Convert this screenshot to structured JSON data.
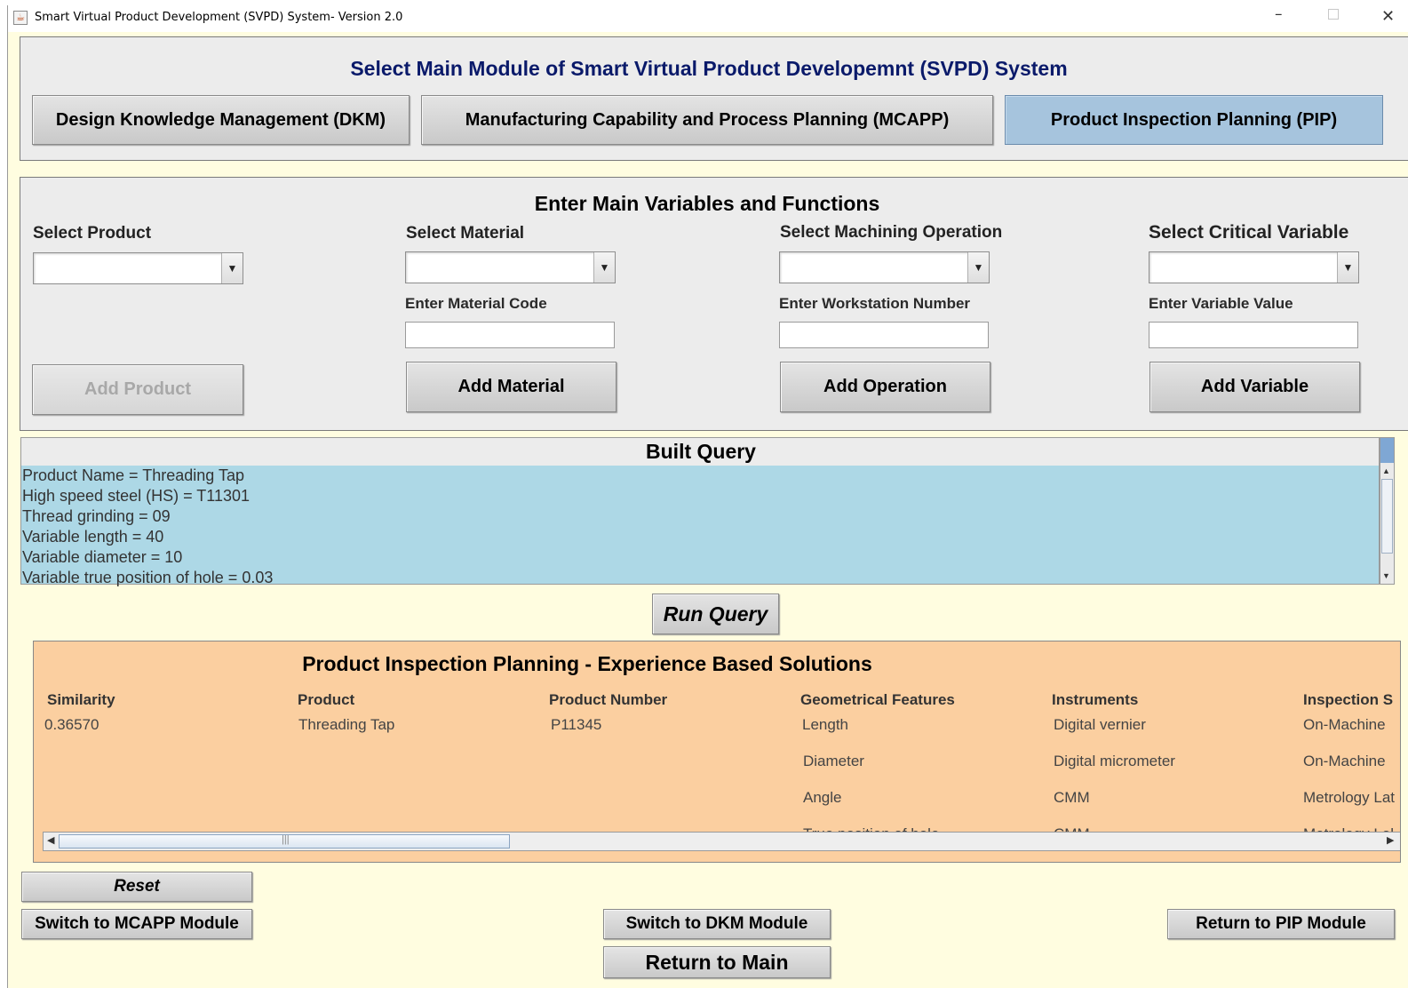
{
  "window": {
    "title": "Smart Virtual Product Development (SVPD) System- Version 2.0",
    "app_icon": "java-icon",
    "controls": {
      "minimize": "–",
      "maximize": "",
      "close": "✕"
    }
  },
  "main_module": {
    "heading": "Select Main Module of Smart Virtual Product Developemnt (SVPD) System",
    "buttons": [
      {
        "label": "Design Knowledge Management (DKM)",
        "active": false
      },
      {
        "label": "Manufacturing Capability and Process Planning (MCAPP)",
        "active": false
      },
      {
        "label": "Product Inspection Planning (PIP)",
        "active": true
      }
    ]
  },
  "variables": {
    "heading": "Enter Main Variables and Functions",
    "product": {
      "label": "Select Product",
      "value": "",
      "button": "Add Product",
      "button_enabled": false
    },
    "material": {
      "label": "Select Material",
      "value": "",
      "code_label": "Enter Material Code",
      "code_value": "",
      "button": "Add Material"
    },
    "operation": {
      "label": "Select Machining Operation",
      "value": "",
      "workstation_label": "Enter Workstation Number",
      "workstation_value": "",
      "button": "Add Operation"
    },
    "variable": {
      "label": "Select Critical Variable",
      "value": "",
      "value_label": "Enter Variable Value",
      "value_value": "",
      "button": "Add Variable"
    }
  },
  "query": {
    "heading": "Built Query",
    "lines": [
      "Product Name = Threading Tap",
      "High speed steel (HS) = T11301",
      "Thread grinding = 09",
      "Variable length = 40",
      "Variable diameter = 10",
      "Variable true position of hole = 0.03"
    ],
    "run_button": "Run Query"
  },
  "results": {
    "heading": "Product Inspection Planning - Experience Based Solutions",
    "columns": [
      "Similarity",
      "Product",
      "Product Number",
      "Geometrical Features",
      "Instruments",
      "Inspection S"
    ],
    "rows": [
      [
        "0.36570",
        "Threading Tap",
        "P11345",
        "Length",
        "Digital vernier",
        "On-Machine"
      ],
      [
        "",
        "",
        "",
        "Diameter",
        "Digital micrometer",
        "On-Machine"
      ],
      [
        "",
        "",
        "",
        "Angle",
        "CMM",
        "Metrology Lat"
      ],
      [
        "",
        "",
        "",
        "True position of hole",
        "CMM",
        "Metrology Lal"
      ]
    ]
  },
  "footer": {
    "reset": "Reset",
    "switch_mcapp": "Switch to MCAPP Module",
    "switch_dkm": "Switch to DKM Module",
    "return_pip": "Return to PIP Module",
    "return_main": "Return to Main"
  },
  "colors": {
    "window_bg": "#fffde0",
    "panel_bg": "#ececec",
    "active_button": "#a6c4dd",
    "query_bg": "#add8e6",
    "results_bg": "#fbcfa0"
  }
}
